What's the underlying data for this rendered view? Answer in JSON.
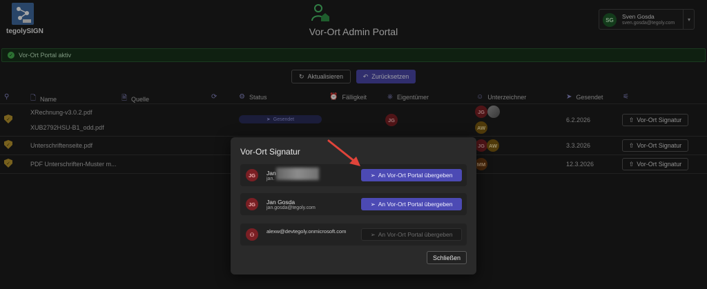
{
  "app": {
    "name": "tegolySIGN",
    "title": "Vor-Ort Admin Portal"
  },
  "user": {
    "initials": "SG",
    "name": "Sven Gosda",
    "email": "sven.gosda@tegoly.com"
  },
  "status": {
    "text": "Vor-Ort Portal aktiv",
    "color": "#46b04f"
  },
  "toolbar": {
    "refresh_label": "Aktualisieren",
    "reset_label": "Zurücksetzen"
  },
  "table": {
    "headers": {
      "name": "Name",
      "source": "Quelle",
      "status": "Status",
      "due": "Fälligkeit",
      "owner": "Eigentümer",
      "signers": "Unterzeichner",
      "sent": "Gesendet"
    },
    "rows": [
      {
        "files": [
          "XRechnung-v3.0.2.pdf",
          "XUB2792HSU-B1_odd.pdf"
        ],
        "status": "Gesendet",
        "owner": "JG",
        "signers": [
          "JG",
          "",
          "AW"
        ],
        "sent": "6.2.2026",
        "action": "Vor-Ort Signatur"
      },
      {
        "files": [
          "Unterschriftenseite.pdf"
        ],
        "signers": [
          "JG",
          "AW"
        ],
        "sent": "3.3.2026",
        "action": "Vor-Ort Signatur"
      },
      {
        "files": [
          "PDF Unterschriften-Muster m..."
        ],
        "signers": [
          "MM"
        ],
        "sent": "12.3.2026",
        "action": "Vor-Ort Signatur"
      }
    ]
  },
  "modal": {
    "title": "Vor-Ort Signatur",
    "entries": [
      {
        "initials": "JG",
        "name": "Jan",
        "email": "jan.",
        "button": "An Vor-Ort Portal übergeben",
        "enabled": true
      },
      {
        "initials": "JG",
        "name": "Jan Gosda",
        "email": "jan.gosda@tegoly.com",
        "button": "An Vor-Ort Portal übergeben",
        "enabled": true
      },
      {
        "initials": "",
        "name": "",
        "email": "alexw@devtegoly.onmicrosoft.com",
        "button": "An Vor-Ort Portal übergeben",
        "enabled": false
      }
    ],
    "close_label": "Schließen"
  },
  "colors": {
    "accent": "#4c4ab4",
    "arrow": "#e0443a"
  }
}
